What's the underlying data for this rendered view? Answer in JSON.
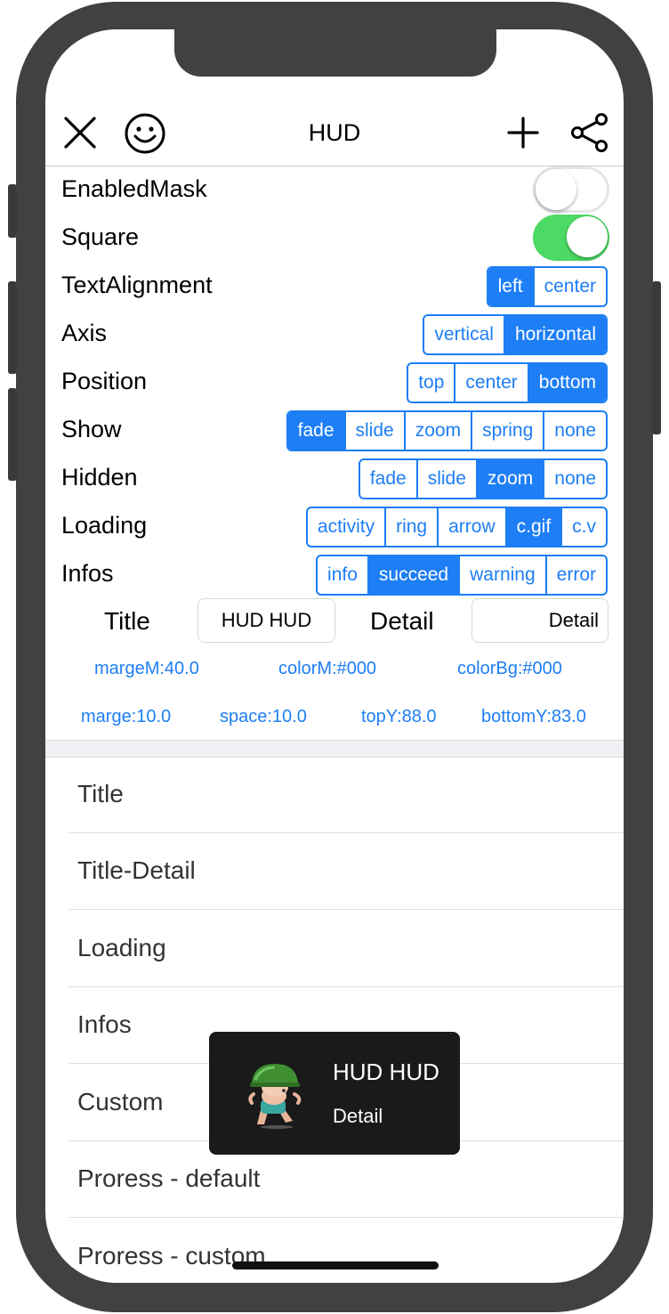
{
  "nav": {
    "title": "HUD",
    "icons": [
      "close-icon",
      "smiley-icon",
      "plus-icon",
      "share-icon"
    ]
  },
  "colors": {
    "accent": "#1e7ef5",
    "toggle_on": "#4cd964",
    "hud_bg": "#1a1a1a"
  },
  "settings": {
    "enabled_mask": {
      "label": "EnabledMask",
      "value": false
    },
    "square": {
      "label": "Square",
      "value": true
    },
    "text_alignment": {
      "label": "TextAlignment",
      "options": [
        "left",
        "center"
      ],
      "selected": "left"
    },
    "axis": {
      "label": "Axis",
      "options": [
        "vertical",
        "horizontal"
      ],
      "selected": "horizontal"
    },
    "position": {
      "label": "Position",
      "options": [
        "top",
        "center",
        "bottom"
      ],
      "selected": "bottom"
    },
    "show": {
      "label": "Show",
      "options": [
        "fade",
        "slide",
        "zoom",
        "spring",
        "none"
      ],
      "selected": "fade"
    },
    "hidden": {
      "label": "Hidden",
      "options": [
        "fade",
        "slide",
        "zoom",
        "none"
      ],
      "selected": "zoom"
    },
    "loading": {
      "label": "Loading",
      "options": [
        "activity",
        "ring",
        "arrow",
        "c.gif",
        "c.v"
      ],
      "selected": "c.gif"
    },
    "infos": {
      "label": "Infos",
      "options": [
        "info",
        "succeed",
        "warning",
        "error"
      ],
      "selected": "succeed"
    }
  },
  "fields": {
    "title_label": "Title",
    "title_value": "HUD HUD",
    "detail_label": "Detail",
    "detail_value": "Detail"
  },
  "params": {
    "marge_m": "margeM:40.0",
    "color_m": "colorM:#000",
    "color_bg": "colorBg:#000",
    "marge": "marge:10.0",
    "space": "space:10.0",
    "top_y": "topY:88.0",
    "bottom_y": "bottomY:83.0"
  },
  "list": [
    "Title",
    "Title-Detail",
    "Loading",
    "Infos",
    "Custom",
    "Proress - default",
    "Proress - custom"
  ],
  "hud": {
    "title": "HUD HUD",
    "detail": "Detail",
    "image": "soldier-icon"
  }
}
